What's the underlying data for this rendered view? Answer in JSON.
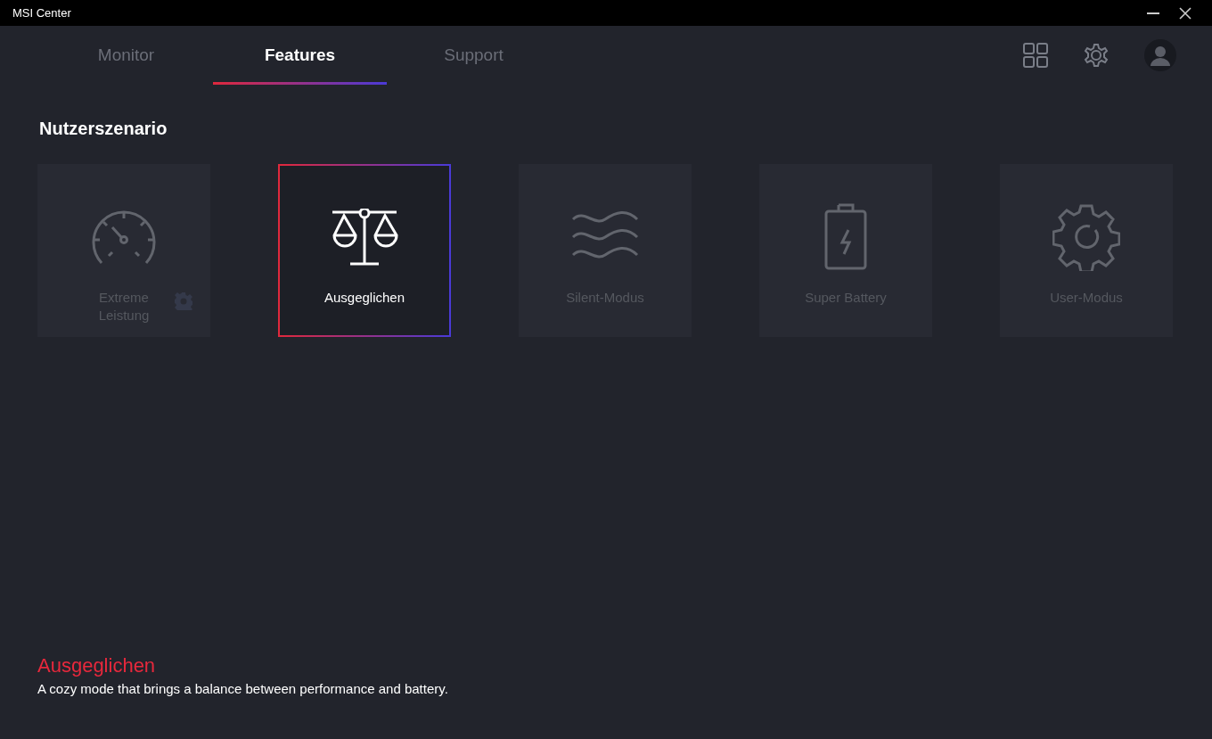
{
  "window": {
    "title": "MSI Center"
  },
  "tabs": [
    {
      "label": "Monitor",
      "selected": false
    },
    {
      "label": "Features",
      "selected": true
    },
    {
      "label": "Support",
      "selected": false
    }
  ],
  "section": {
    "title": "Nutzerszenario"
  },
  "modes": [
    {
      "kind": "gauge",
      "label": "Extreme\nLeistung",
      "selected": false,
      "settings": true
    },
    {
      "kind": "scale",
      "label": "Ausgeglichen",
      "selected": true,
      "settings": false
    },
    {
      "kind": "waves",
      "label": "Silent-Modus",
      "selected": false,
      "settings": false
    },
    {
      "kind": "battery",
      "label": "Super Battery",
      "selected": false,
      "settings": false
    },
    {
      "kind": "gear",
      "label": "User-Modus",
      "selected": false,
      "settings": false
    }
  ],
  "description": {
    "title": "Ausgeglichen",
    "text": "A cozy mode that brings a balance between performance and battery."
  }
}
